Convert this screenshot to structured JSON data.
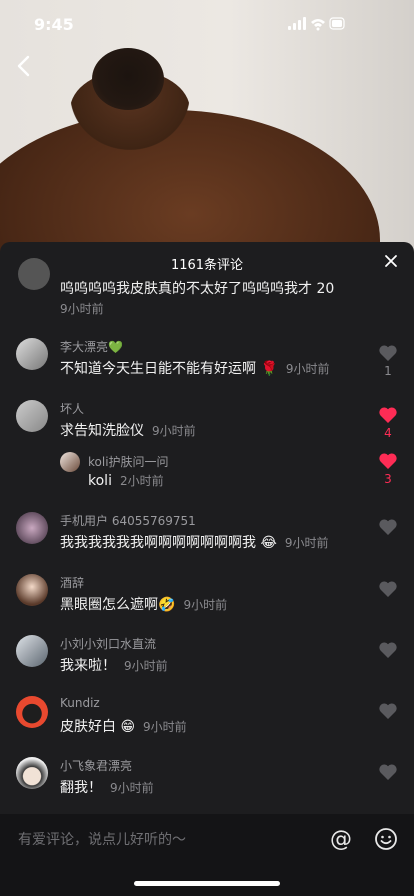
{
  "status": {
    "time": "9:45"
  },
  "panel": {
    "title": "1161条评论"
  },
  "comments": [
    {
      "user": "",
      "text": "呜呜呜呜我皮肤真的不太好了呜呜呜我才 20",
      "time": "9小时前",
      "likes": ""
    },
    {
      "user": "李大漂亮💚",
      "text": "不知道今天生日能不能有好运啊 🌹",
      "time": "9小时前",
      "likes": "1"
    },
    {
      "user": "坏人",
      "text": "求告知洗脸仪",
      "time": "9小时前",
      "likes": "4"
    },
    {
      "user": "koli护肤问一问",
      "text": "koli",
      "time": "2小时前",
      "likes": "3"
    },
    {
      "user": "手机用户 64055769751",
      "text": "我我我我我我啊啊啊啊啊啊啊我 😂",
      "time": "9小时前",
      "likes": ""
    },
    {
      "user": "酒辞",
      "text": "黑眼圈怎么遮啊🤣",
      "time": "9小时前",
      "likes": ""
    },
    {
      "user": "小刘小刘口水直流",
      "text": "我来啦！",
      "time": "9小时前",
      "likes": ""
    },
    {
      "user": "Kundiz",
      "text": "皮肤好白 😁",
      "time": "9小时前",
      "likes": ""
    },
    {
      "user": "小飞象君漂亮",
      "text": "翻我！",
      "time": "9小时前",
      "likes": ""
    }
  ],
  "input": {
    "placeholder": "有爱评论，说点儿好听的～",
    "at": "@"
  },
  "colors": {
    "accent": "#fe2c55",
    "panel": "#1d1d1f"
  }
}
